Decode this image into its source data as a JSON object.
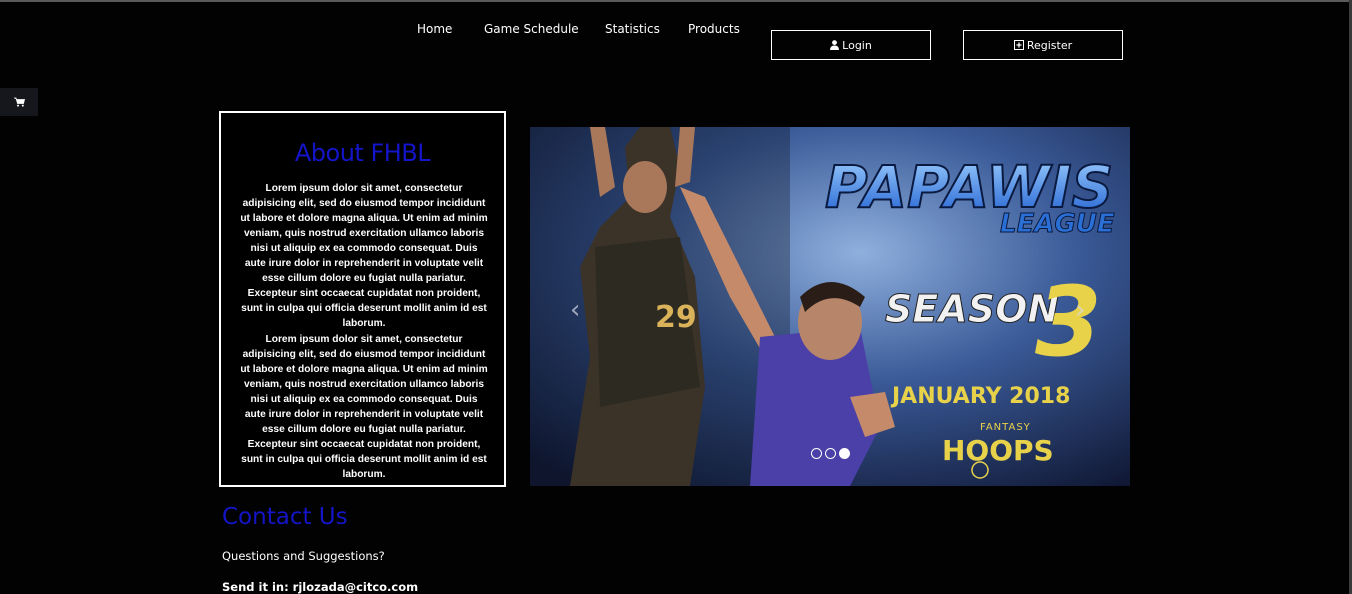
{
  "nav": {
    "items": [
      "Home",
      "Game Schedule",
      "Statistics",
      "Products"
    ]
  },
  "auth": {
    "login_label": "Login",
    "register_label": "Register"
  },
  "cart": {
    "icon": "shopping-cart-icon"
  },
  "about": {
    "title": "About FHBL",
    "paragraphs": [
      "Lorem ipsum dolor sit amet, consectetur adipisicing elit, sed do eiusmod tempor incididunt ut labore et dolore magna aliqua. Ut enim ad minim veniam, quis nostrud exercitation ullamco laboris nisi ut aliquip ex ea commodo consequat. Duis aute irure dolor in reprehenderit in voluptate velit esse cillum dolore eu fugiat nulla pariatur. Excepteur sint occaecat cupidatat non proident, sunt in culpa qui officia deserunt mollit anim id est laborum.",
      "Lorem ipsum dolor sit amet, consectetur adipisicing elit, sed do eiusmod tempor incididunt ut labore et dolore magna aliqua. Ut enim ad minim veniam, quis nostrud exercitation ullamco laboris nisi ut aliquip ex ea commodo consequat. Duis aute irure dolor in reprehenderit in voluptate velit esse cillum dolore eu fugiat nulla pariatur. Excepteur sint occaecat cupidatat non proident, sunt in culpa qui officia deserunt mollit anim id est laborum."
    ]
  },
  "carousel": {
    "slide": {
      "brand_line1": "PAPAWIS",
      "brand_line2": "LEAGUE",
      "season_text": "SEASON",
      "season_number": "3",
      "date_text": "JANUARY 2018",
      "sponsor_top": "FANTASY",
      "sponsor_main": "HOOPS",
      "jersey_number": "29"
    },
    "indicator_count": 3,
    "active_index": 2
  },
  "contact": {
    "title": "Contact Us",
    "question": "Questions and Suggestions?",
    "send_text": "Send it in: rjlozada@citco.com"
  },
  "colors": {
    "background": "#020202",
    "heading_blue": "#1414c8",
    "slide_yellow": "#e8d24a",
    "slide_blue": "#2a6fd6"
  }
}
